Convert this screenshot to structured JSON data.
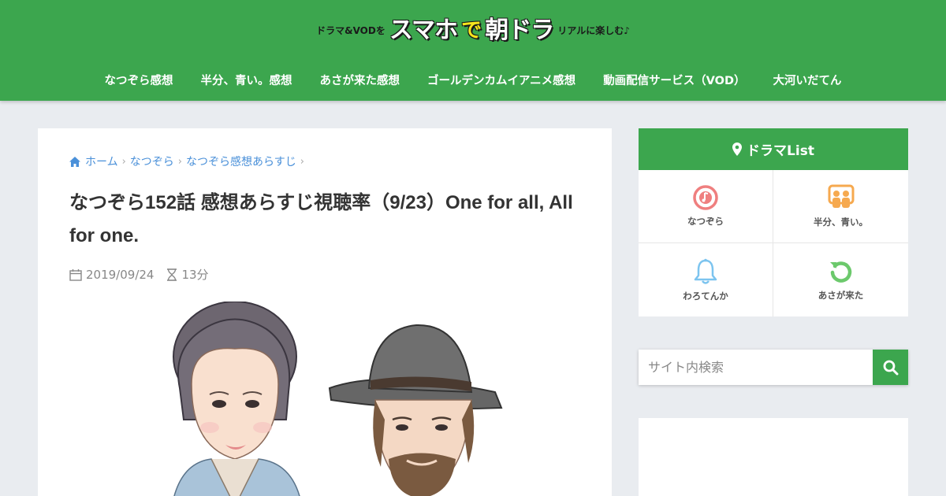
{
  "header": {
    "logo": {
      "part1": "ドラマ&VODを",
      "part2": "スマホ",
      "part3": "で",
      "part4": "朝ドラ",
      "part5": "リアルに楽しむ♪"
    },
    "nav": [
      "なつぞら感想",
      "半分、青い。感想",
      "あさが来た感想",
      "ゴールデンカムイアニメ感想",
      "動画配信サービス（VOD）",
      "大河いだてん"
    ]
  },
  "breadcrumb": {
    "home": "ホーム",
    "items": [
      "なつぞら",
      "なつぞら感想あらすじ"
    ]
  },
  "article": {
    "title": "なつぞら152話 感想あらすじ視聴率（9/23）One for all, All for one.",
    "date": "2019/09/24",
    "read_time": "13分"
  },
  "sidebar": {
    "widget_title": "ドラマList",
    "items": [
      {
        "label": "なつぞら",
        "icon": "music-note-icon",
        "color": "#ef7f7f"
      },
      {
        "label": "半分、青い。",
        "icon": "people-icon",
        "color": "#f6a94f"
      },
      {
        "label": "わろてんか",
        "icon": "bell-icon",
        "color": "#7cc4ef"
      },
      {
        "label": "あさが来た",
        "icon": "refresh-icon",
        "color": "#6cc96c"
      }
    ],
    "search_placeholder": "サイト内検索"
  },
  "colors": {
    "brand_green": "#3ca64e",
    "link_blue": "#4a90d9",
    "background": "#e9ecf0"
  }
}
